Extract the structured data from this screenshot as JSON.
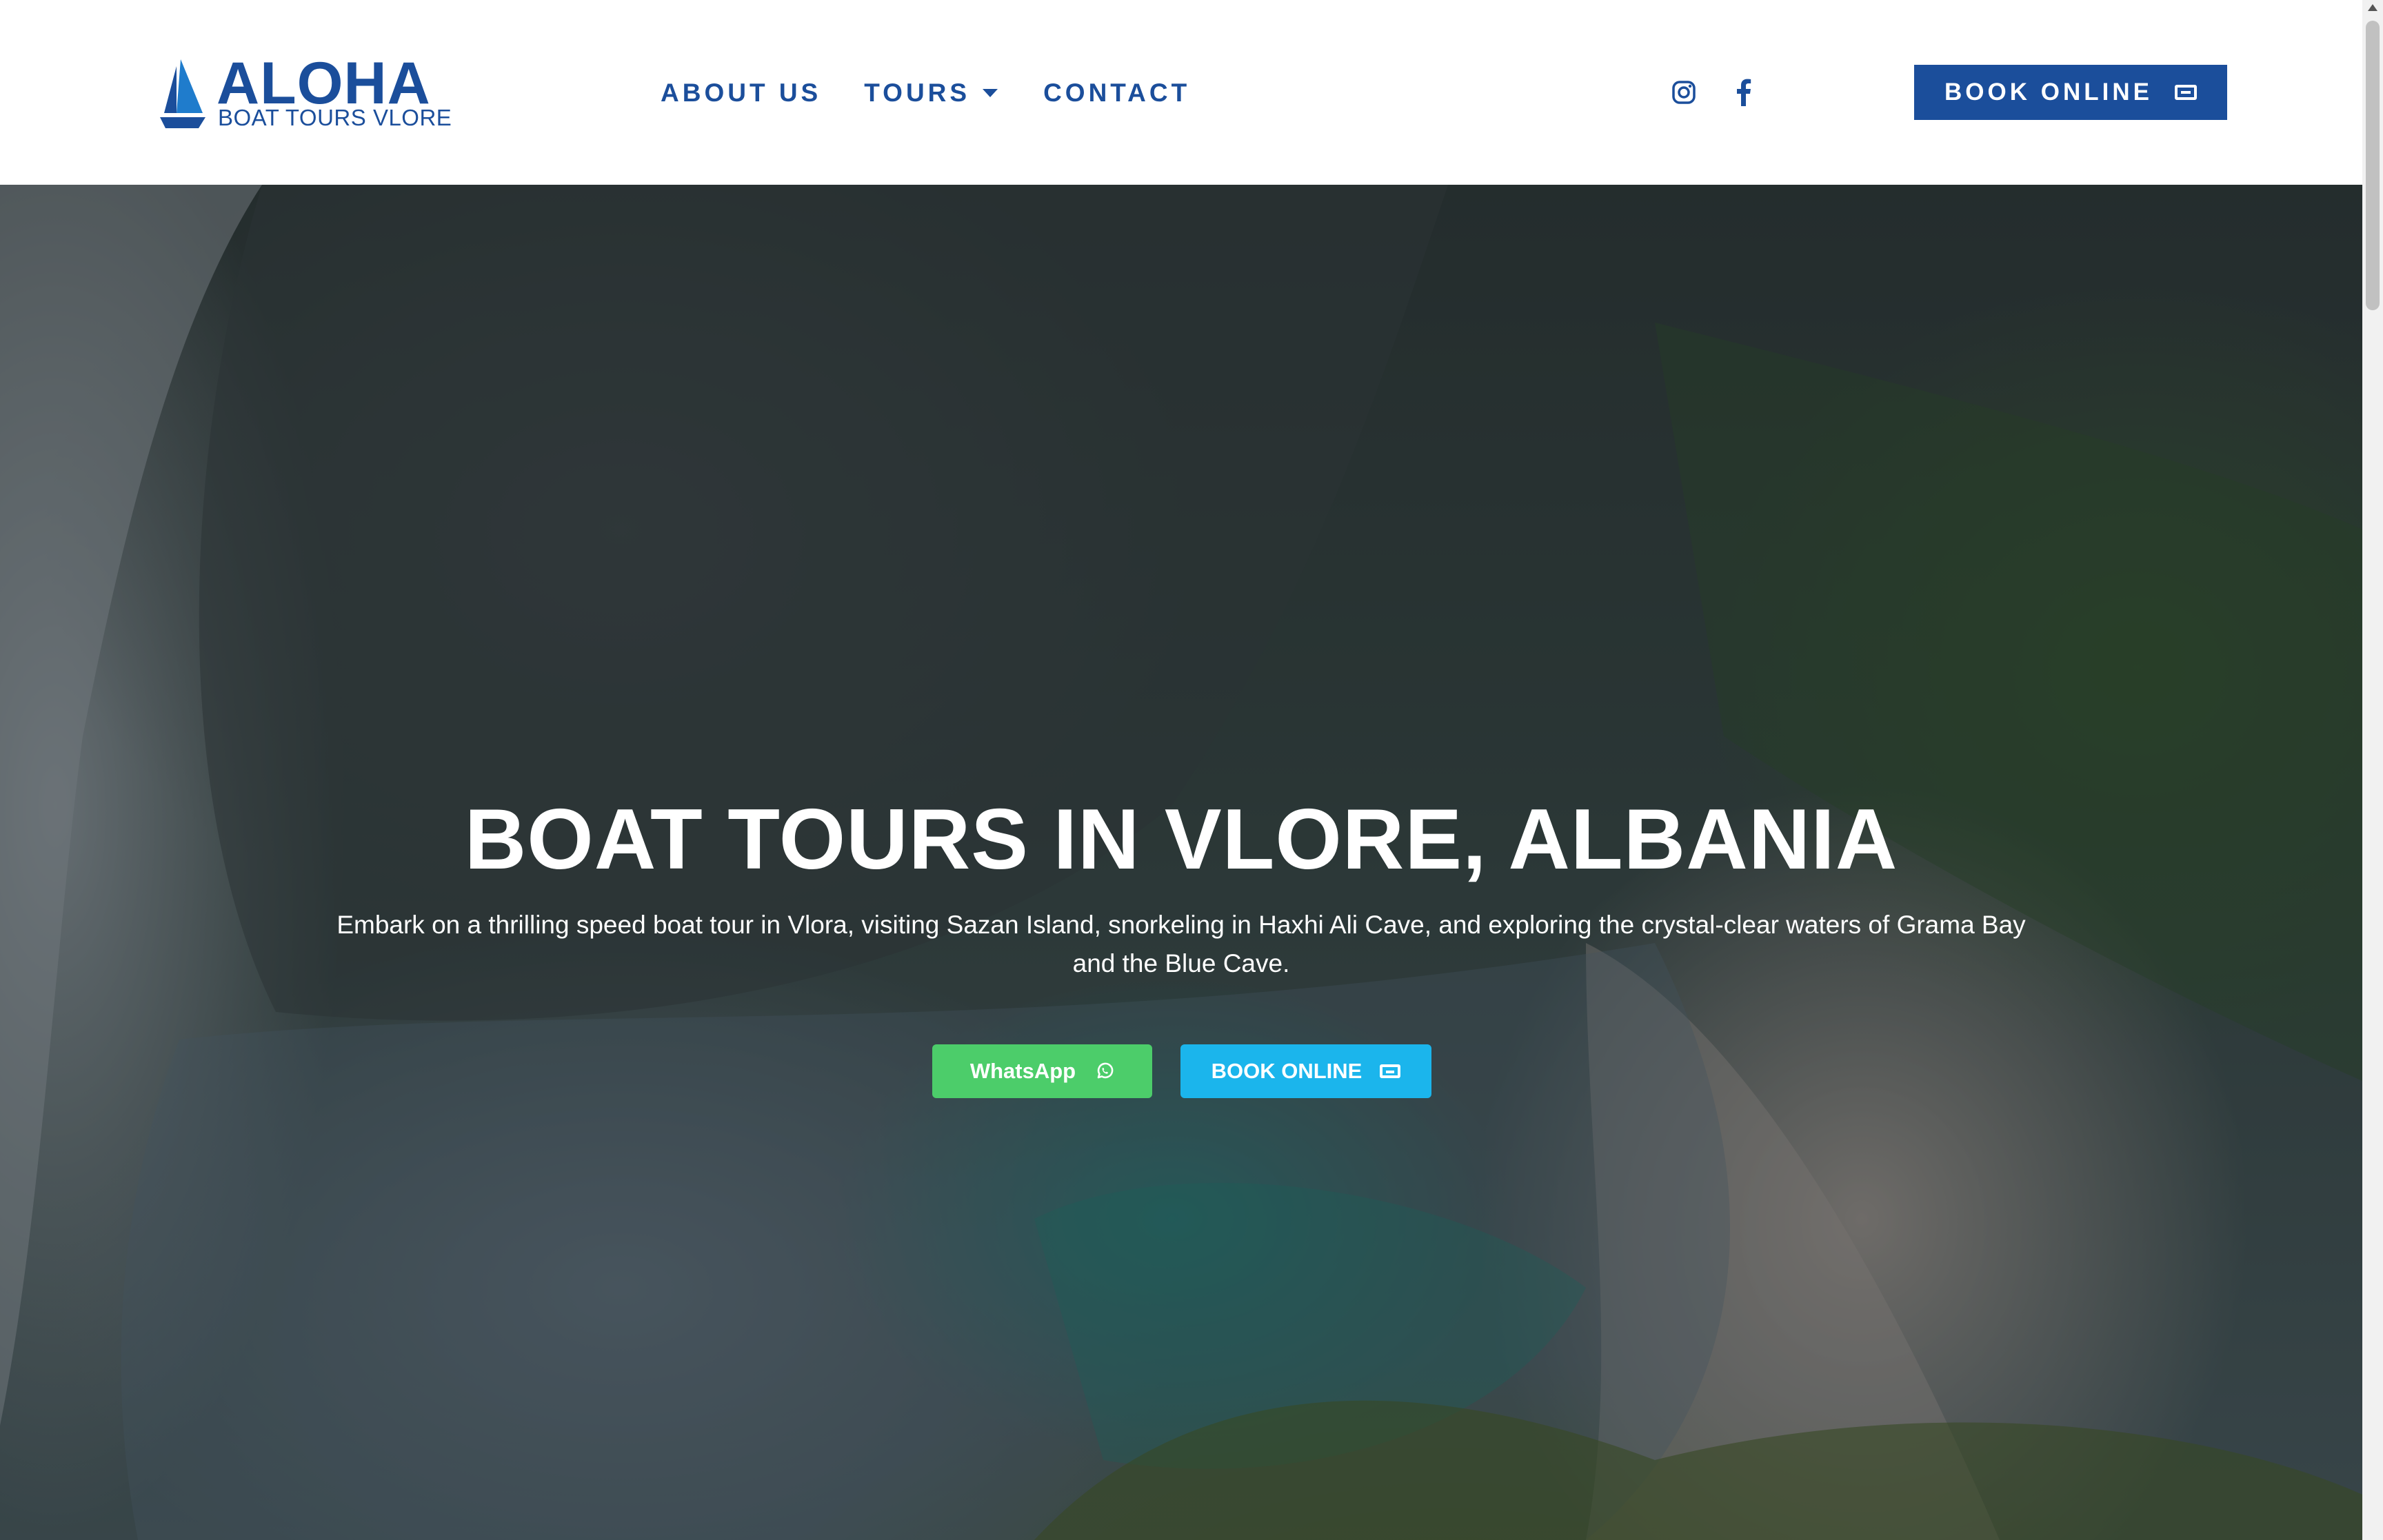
{
  "header": {
    "logo": {
      "brand": "ALOHA",
      "tagline": "BOAT TOURS VLORE"
    },
    "nav": [
      {
        "label": "ABOUT US"
      },
      {
        "label": "TOURS"
      },
      {
        "label": "CONTACT"
      }
    ],
    "social": [
      "instagram-icon",
      "facebook-icon"
    ],
    "book_label": "BOOK ONLINE"
  },
  "hero": {
    "title": "BOAT TOURS IN VLORE, ALBANIA",
    "description": "Embark on a thrilling speed boat tour in Vlora, visiting Sazan Island, snorkeling in Haxhi Ali Cave, and exploring the crystal-clear waters of Grama Bay and the Blue Cave.",
    "whatsapp_label": "WhatsApp",
    "book_label": "BOOK ONLINE"
  },
  "colors": {
    "brand": "#1b4e9b",
    "whatsapp": "#4ccd6a",
    "book": "#1bb5ec"
  }
}
